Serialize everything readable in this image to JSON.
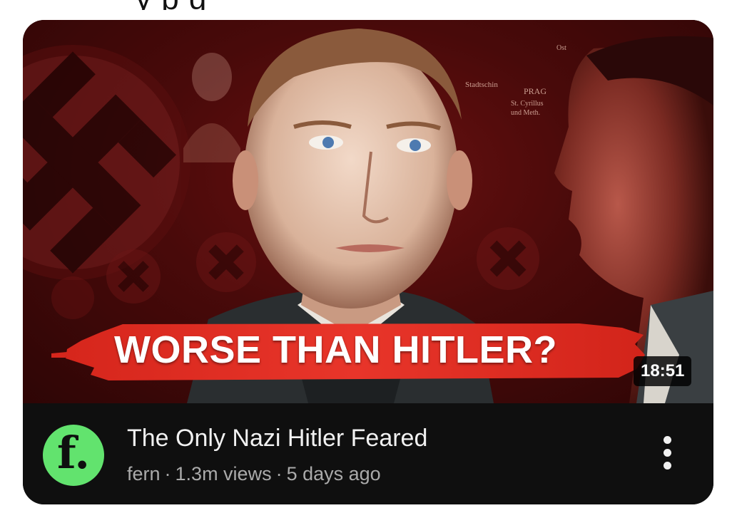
{
  "video": {
    "title": "The Only Nazi Hitler Feared",
    "thumbnail_text": "WORSE THAN HITLER?",
    "duration": "18:51",
    "channel": "fern",
    "views": "1.3m views",
    "age": "5 days ago",
    "separator": "·",
    "avatar_letter": "f.",
    "menu_icon": "more-vertical-icon"
  },
  "map_labels": {
    "label1": "Stadtschin",
    "label2": "PRAG",
    "label3": "St. Cyrillus",
    "label4": "und Meth.",
    "label5": "Ost"
  },
  "colors": {
    "avatar_bg": "#62e36e",
    "banner_red": "#e02a1f",
    "meta_bg": "#0f0f0f",
    "title_text": "#f1f1f1",
    "secondary_text": "#aaaaaa"
  }
}
